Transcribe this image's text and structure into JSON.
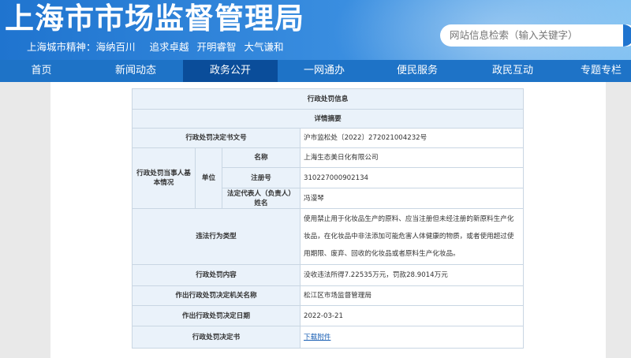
{
  "header": {
    "title": "上海市市场监督管理局",
    "motto": [
      "上海城市精神：海纳百川",
      "追求卓越",
      "开明睿智",
      "大气谦和"
    ],
    "search_placeholder": "网站信息检索（输入关键字）"
  },
  "nav": {
    "items": [
      "首页",
      "新闻动态",
      "政务公开",
      "一网通办",
      "便民服务",
      "政民互动",
      "专题专栏"
    ],
    "active_index": 2
  },
  "table": {
    "title": "行政处罚信息",
    "section": "详情摘要",
    "decision_no_label": "行政处罚决定书文号",
    "decision_no": "沪市监松处〔2022〕272021004232号",
    "party_label": "行政处罚当事人基本情况",
    "unit_label": "单位",
    "name_label": "名称",
    "name": "上海生态美日化有限公司",
    "reg_label": "注册号",
    "reg": "310227000902134",
    "rep_label": "法定代表人（负责人）姓名",
    "rep": "冯漫琴",
    "violation_label": "违法行为类型",
    "violation": "使用禁止用于化妆品生产的原料、应当注册但未经注册的新原料生产化妆品，在化妆品中非法添加可能危害人体健康的物质，或者使用超过使用期限、废弃、回收的化妆品或者原料生产化妆品。",
    "content_label": "行政处罚内容",
    "content": "没收违法所得7.22535万元，罚款28.9014万元",
    "agency_label": "作出行政处罚决定机关名称",
    "agency": "松江区市场监督管理局",
    "date_label": "作出行政处罚决定日期",
    "date": "2022-03-21",
    "doc_label": "行政处罚决定书",
    "doc_link": "下载附件"
  }
}
